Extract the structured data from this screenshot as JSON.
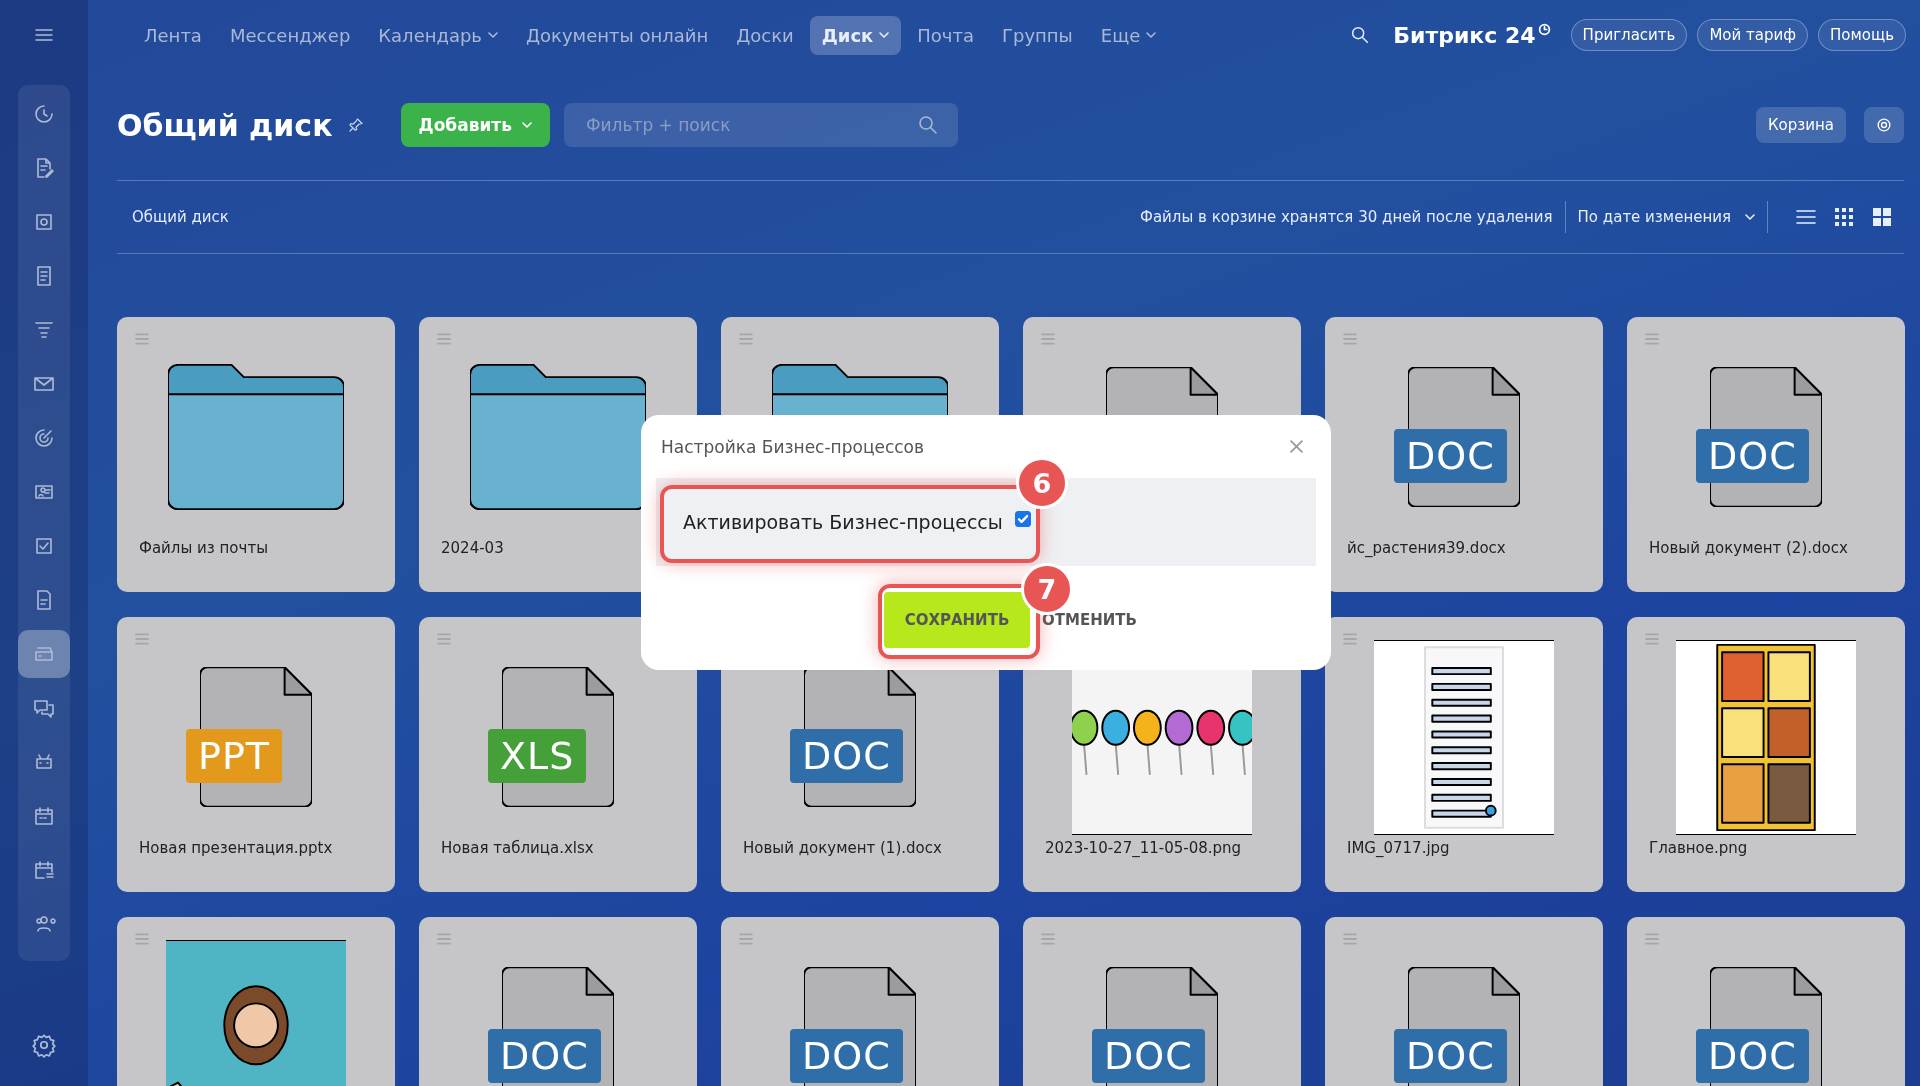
{
  "top_nav": {
    "items": [
      {
        "label": "Лента",
        "selected": false,
        "dropdown": false
      },
      {
        "label": "Мессенджер",
        "selected": false,
        "dropdown": false
      },
      {
        "label": "Календарь",
        "selected": false,
        "dropdown": true
      },
      {
        "label": "Документы онлайн",
        "selected": false,
        "dropdown": false
      },
      {
        "label": "Доски",
        "selected": false,
        "dropdown": false
      },
      {
        "label": "Диск",
        "selected": true,
        "dropdown": true
      },
      {
        "label": "Почта",
        "selected": false,
        "dropdown": false
      },
      {
        "label": "Группы",
        "selected": false,
        "dropdown": false
      },
      {
        "label": "Еще",
        "selected": false,
        "dropdown": true
      }
    ],
    "logo": "Битрикс 24",
    "buttons": [
      "Пригласить",
      "Мой тариф",
      "Помощь"
    ]
  },
  "sidebar": {
    "items": [
      {
        "selected": false
      },
      {
        "selected": false
      },
      {
        "selected": false
      },
      {
        "selected": false
      },
      {
        "selected": false
      },
      {
        "selected": false
      },
      {
        "selected": false
      },
      {
        "selected": false
      },
      {
        "selected": false
      },
      {
        "selected": false
      },
      {
        "selected": true
      },
      {
        "selected": false
      },
      {
        "selected": false
      },
      {
        "selected": false
      },
      {
        "selected": false
      },
      {
        "selected": false
      }
    ]
  },
  "header": {
    "title": "Общий диск",
    "add_button": "Добавить",
    "search": {
      "placeholder": "Фильтр + поиск"
    },
    "trash_button": "Корзина"
  },
  "breadcrumb_bar": {
    "path": "Общий диск",
    "note": "Файлы в корзине хранятся 30 дней после удаления",
    "sort": "По дате изменения"
  },
  "cards": [
    {
      "kind": "folder",
      "name": "Файлы из почты"
    },
    {
      "kind": "folder",
      "name": "2024-03"
    },
    {
      "kind": "folder"
    },
    {
      "kind": "file"
    },
    {
      "kind": "file",
      "badge": "DOC",
      "color": "#2f6ea8",
      "name": "йс_растения39.docx"
    },
    {
      "kind": "file",
      "badge": "DOC",
      "color": "#2f6ea8",
      "name": "Новый документ (2).docx"
    },
    {
      "kind": "file",
      "badge": "PPT",
      "color": "#e39a1c",
      "name": "Новая презентация.pptx"
    },
    {
      "kind": "file",
      "badge": "XLS",
      "color": "#45a03a",
      "name": "Новая таблица.xlsx"
    },
    {
      "kind": "file",
      "badge": "DOC",
      "color": "#2f6ea8",
      "name": "Новый документ (1).docx"
    },
    {
      "kind": "picture",
      "name": "2023-10-27_11-05-08.png"
    },
    {
      "kind": "picture",
      "name": "IMG_0717.jpg"
    },
    {
      "kind": "picture",
      "name": "Главное.png"
    },
    {
      "kind": "picture"
    },
    {
      "kind": "file",
      "badge": "DOC",
      "color": "#2f6ea8"
    },
    {
      "kind": "file",
      "badge": "DOC",
      "color": "#2f6ea8"
    },
    {
      "kind": "file",
      "badge": "DOC",
      "color": "#2f6ea8"
    },
    {
      "kind": "file",
      "badge": "DOC",
      "color": "#2f6ea8"
    },
    {
      "kind": "file",
      "badge": "DOC",
      "color": "#2f6ea8"
    }
  ],
  "dialog": {
    "title": "Настройка Бизнес-процессов",
    "option": {
      "label": "Активировать Бизнес-процессы",
      "checked": true
    },
    "buttons": [
      "СОХРАНИТЬ",
      "ОТМЕНИТЬ"
    ],
    "annotations": [
      {
        "number": "6"
      },
      {
        "number": "7"
      }
    ]
  }
}
